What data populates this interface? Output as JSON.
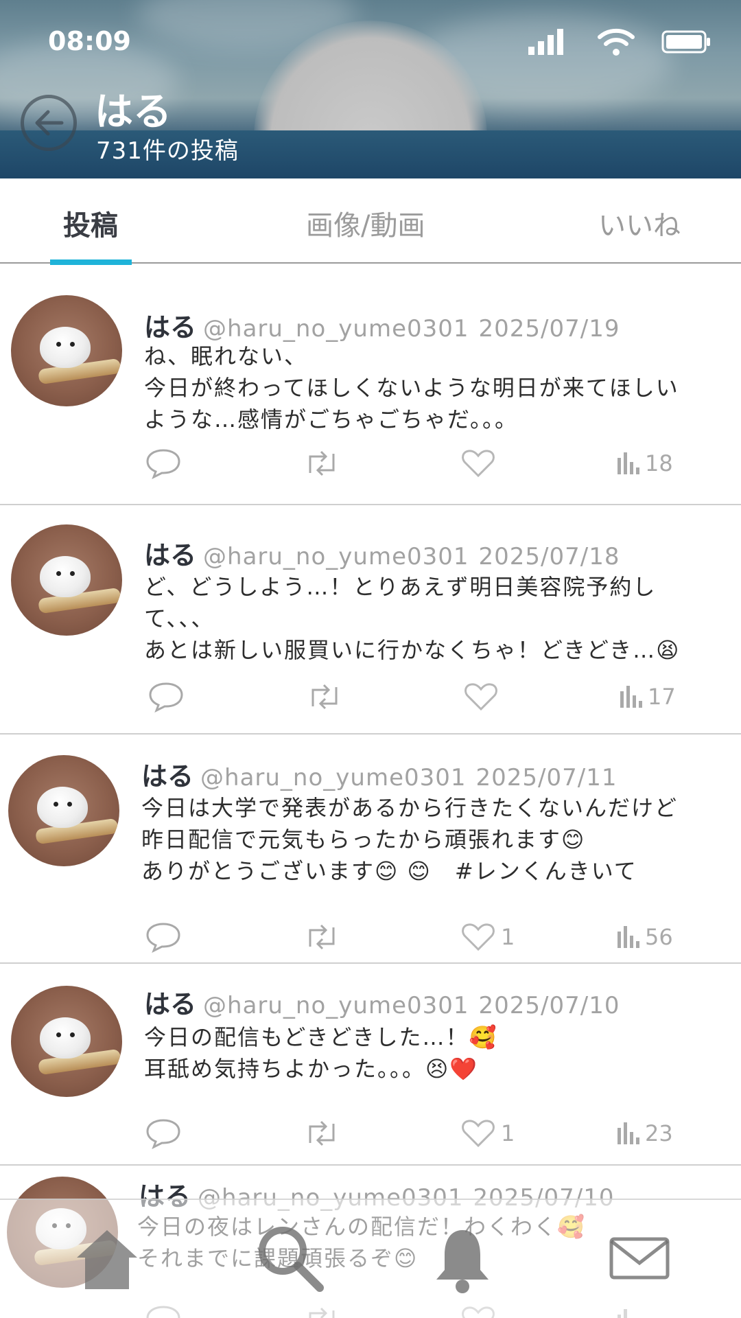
{
  "status_bar": {
    "time": "08:09"
  },
  "profile": {
    "name": "はる",
    "post_count": "731件の投稿"
  },
  "tabs": [
    {
      "label": "投稿",
      "active": true
    },
    {
      "label": "画像/動画",
      "active": false
    },
    {
      "label": "いいね",
      "active": false
    }
  ],
  "posts": [
    {
      "name": "はる",
      "handle": "@haru_no_yume0301",
      "date": "2025/07/19",
      "lines": [
        "ね、眠れない、",
        "今日が終わってほしくないような明日が来てほしい",
        "ような…感情がごちゃごちゃだ。。。"
      ],
      "likes": "",
      "views": "18"
    },
    {
      "name": "はる",
      "handle": "@haru_no_yume0301",
      "date": "2025/07/18",
      "lines": [
        "ど、どうしよう…！とりあえず明日美容院予約し",
        "て、、、",
        "あとは新しい服買いに行かなくちゃ！どきどき…😫"
      ],
      "likes": "",
      "views": "17"
    },
    {
      "name": "はる",
      "handle": "@haru_no_yume0301",
      "date": "2025/07/11",
      "lines": [
        "今日は大学で発表があるから行きたくないんだけど",
        "昨日配信で元気もらったから頑張れます😊",
        "ありがとうございます😊 😊　#レンくんきいて"
      ],
      "likes": "1",
      "views": "56"
    },
    {
      "name": "はる",
      "handle": "@haru_no_yume0301",
      "date": "2025/07/10",
      "lines": [
        "今日の配信もどきどきした…！🥰",
        "耳舐め気持ちよかった。。。😣❤️"
      ],
      "likes": "1",
      "views": "23"
    },
    {
      "name": "はる",
      "handle": "@haru_no_yume0301",
      "date": "2025/07/10",
      "lines": [
        "今日の夜はレンさんの配信だ！わくわく🥰",
        "それまでに課題頑張るぞ😊"
      ],
      "likes": "",
      "views": ""
    }
  ],
  "icons": {
    "back": "arrow-left-circle-icon",
    "reply": "speech-bubble-icon",
    "repost": "repost-icon",
    "like": "heart-icon",
    "views": "bar-chart-icon",
    "nav": [
      "home-icon",
      "search-icon",
      "bell-icon",
      "mail-icon"
    ]
  },
  "colors": {
    "accent": "#1fb3d9",
    "muted": "#a2a2a2",
    "text": "#2d2d2d"
  }
}
